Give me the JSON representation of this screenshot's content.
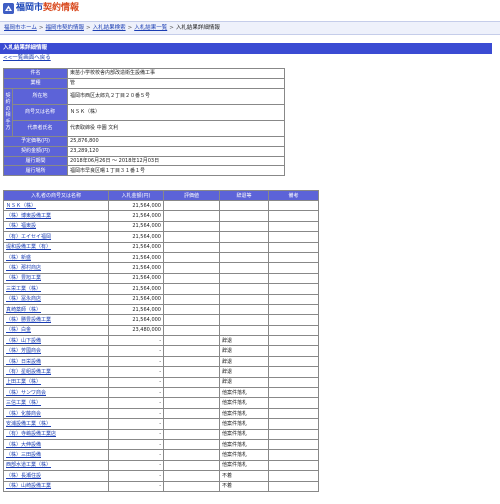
{
  "header": {
    "logo_city": "福岡市",
    "logo_service": "契約情報"
  },
  "breadcrumb": [
    {
      "label": "福岡市ホーム",
      "link": true
    },
    {
      "label": "福岡市契約情報",
      "link": true
    },
    {
      "label": "入札結果検索",
      "link": true
    },
    {
      "label": "入札結果一覧",
      "link": true
    },
    {
      "label": "入札結果詳細情報",
      "link": false
    }
  ],
  "breadcrumb_sep": ">",
  "section_title": "入札結果詳細情報",
  "back_link": "<<一覧画面へ戻る",
  "info": {
    "group_label": "契約の相手方",
    "rows": [
      {
        "label": "件名",
        "value": "東苗小学校校舎内部改造衛生設備工事"
      },
      {
        "label": "業種",
        "value": "管"
      },
      {
        "label": "所在地",
        "value": "福岡市西区太郎丸２丁目２０番５号"
      },
      {
        "label": "商号又は名称",
        "value": "ＮＳＫ（株）"
      },
      {
        "label": "代表者氏名",
        "value": "代表取締役 中園 文利"
      },
      {
        "label": "予定価格(円)",
        "value": "25,876,800"
      },
      {
        "label": "契約金額(円)",
        "value": "23,289,120"
      },
      {
        "label": "履行期間",
        "value": "2018年06月26日 ～ 2018年12月03日"
      },
      {
        "label": "履行場所",
        "value": "福岡市早良区曙１丁目３１番１号"
      }
    ]
  },
  "bids": {
    "headers": [
      "入札者の商号又は名称",
      "入札金額(円)",
      "評価値",
      "辞退等",
      "備考"
    ],
    "rows": [
      {
        "name": "ＮＳＫ（株）",
        "amount": "21,564,000",
        "score": "",
        "status": "",
        "note": ""
      },
      {
        "name": "（株）博東設備工業",
        "amount": "21,564,000",
        "score": "",
        "status": "",
        "note": ""
      },
      {
        "name": "（株）福東設",
        "amount": "21,564,000",
        "score": "",
        "status": "",
        "note": ""
      },
      {
        "name": "（有）エイセイ福岡",
        "amount": "21,564,000",
        "score": "",
        "status": "",
        "note": ""
      },
      {
        "name": "堤和設備工業（有）",
        "amount": "21,564,000",
        "score": "",
        "status": "",
        "note": ""
      },
      {
        "name": "（株）新盛",
        "amount": "21,564,000",
        "score": "",
        "status": "",
        "note": ""
      },
      {
        "name": "（株）那村商店",
        "amount": "21,564,000",
        "score": "",
        "status": "",
        "note": ""
      },
      {
        "name": "（株）豊旭工業",
        "amount": "21,564,000",
        "score": "",
        "status": "",
        "note": ""
      },
      {
        "name": "三栄工業（株）",
        "amount": "21,564,000",
        "score": "",
        "status": "",
        "note": ""
      },
      {
        "name": "（株）冨永商店",
        "amount": "21,564,000",
        "score": "",
        "status": "",
        "note": ""
      },
      {
        "name": "真崎薬師（株）",
        "amount": "21,564,000",
        "score": "",
        "status": "",
        "note": ""
      },
      {
        "name": "（株）勝豊設備工業",
        "amount": "21,564,000",
        "score": "",
        "status": "",
        "note": ""
      },
      {
        "name": "（株）白金",
        "amount": "23,480,000",
        "score": "",
        "status": "",
        "note": ""
      },
      {
        "name": "（株）山下設備",
        "amount": "-",
        "score": "",
        "status": "辞退",
        "note": ""
      },
      {
        "name": "（株）芳國商会",
        "amount": "-",
        "score": "",
        "status": "辞退",
        "note": ""
      },
      {
        "name": "（株）日栄設備",
        "amount": "-",
        "score": "",
        "status": "辞退",
        "note": ""
      },
      {
        "name": "（有）星組設備工業",
        "amount": "-",
        "score": "",
        "status": "辞退",
        "note": ""
      },
      {
        "name": "上田工業（株）",
        "amount": "-",
        "score": "",
        "status": "辞退",
        "note": ""
      },
      {
        "name": "（株）サンワ商会",
        "amount": "-",
        "score": "",
        "status": "他案件落札",
        "note": ""
      },
      {
        "name": "三信工業（株）",
        "amount": "-",
        "score": "",
        "status": "他案件落札",
        "note": ""
      },
      {
        "name": "（株）化藤商会",
        "amount": "-",
        "score": "",
        "status": "他案件落札",
        "note": ""
      },
      {
        "name": "安浦設備工業（株）",
        "amount": "-",
        "score": "",
        "status": "他案件落札",
        "note": ""
      },
      {
        "name": "（有）寺嶋設備工業店",
        "amount": "-",
        "score": "",
        "status": "他案件落札",
        "note": ""
      },
      {
        "name": "（株）大伸設備",
        "amount": "-",
        "score": "",
        "status": "他案件落札",
        "note": ""
      },
      {
        "name": "（株）三田設備",
        "amount": "-",
        "score": "",
        "status": "他案件落札",
        "note": ""
      },
      {
        "name": "西部水道工業（株）",
        "amount": "-",
        "score": "",
        "status": "他案件落札",
        "note": ""
      },
      {
        "name": "（株）長瀬住設",
        "amount": "-",
        "score": "",
        "status": "不着",
        "note": ""
      },
      {
        "name": "（株）山崎設備工業",
        "amount": "-",
        "score": "",
        "status": "不着",
        "note": ""
      }
    ]
  },
  "colors": {
    "header_blue": "#5c63d8",
    "title_bar": "#3a4bd3",
    "link": "#1a3db3",
    "logo_accent": "#d94a1f"
  }
}
